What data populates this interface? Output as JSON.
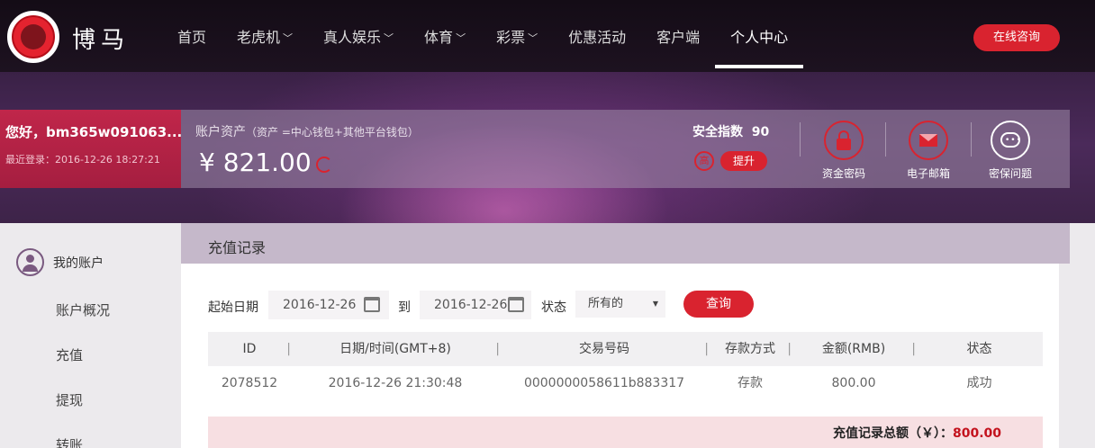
{
  "brand": {
    "name": "博马"
  },
  "nav": {
    "items": [
      {
        "label": "首页",
        "dropdown": false
      },
      {
        "label": "老虎机",
        "dropdown": true
      },
      {
        "label": "真人娱乐",
        "dropdown": true
      },
      {
        "label": "体育",
        "dropdown": true
      },
      {
        "label": "彩票",
        "dropdown": true
      },
      {
        "label": "优惠活动",
        "dropdown": false
      },
      {
        "label": "客户端",
        "dropdown": false
      },
      {
        "label": "个人中心",
        "dropdown": false,
        "active": true
      }
    ],
    "consult_label": "在线咨询"
  },
  "account": {
    "greeting": "您好，bm365w091063...",
    "last_login": "最近登录：2016-12-26 18:27:21",
    "asset_label": "账户资产",
    "asset_note": "（资产 =中心钱包+其他平台钱包）",
    "asset_amount": "¥ 821.00",
    "safety_label": "安全指数",
    "safety_score": "90",
    "safety_level": "高",
    "upgrade_label": "提升",
    "security_items": [
      {
        "label": "资金密码",
        "icon": "lock-icon"
      },
      {
        "label": "电子邮箱",
        "icon": "mail-icon"
      },
      {
        "label": "密保问题",
        "icon": "chat-icon"
      }
    ]
  },
  "sidebar": {
    "section_label": "我的账户",
    "items": [
      "账户概况",
      "充值",
      "提现",
      "转账"
    ]
  },
  "main": {
    "title": "充值记录",
    "filters": {
      "start_label": "起始日期",
      "start_date": "2016-12-26",
      "to_label": "到",
      "end_date": "2016-12-26",
      "status_label": "状态",
      "status_value": "所有的",
      "query_label": "查询"
    },
    "table": {
      "headers": [
        "ID",
        "日期/时间(GMT+8)",
        "交易号码",
        "存款方式",
        "金额(RMB)",
        "状态"
      ],
      "rows": [
        [
          "2078512",
          "2016-12-26 21:30:48",
          "0000000058611b883317",
          "存款",
          "800.00",
          "成功"
        ]
      ]
    },
    "total_label": "充值记录总额（￥）：",
    "total_amount": "800.00"
  },
  "colors": {
    "accent": "#d9232f",
    "header_bg": "#1a1020",
    "greet_bg": "#b0224a"
  }
}
